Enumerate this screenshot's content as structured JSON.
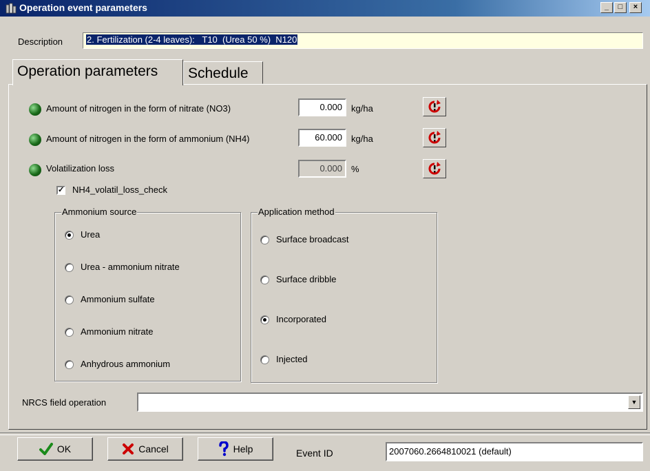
{
  "window": {
    "title": "Operation event parameters",
    "minimize_label": "_",
    "maximize_label": "□",
    "close_label": "×"
  },
  "description": {
    "label": "Description",
    "value": "2. Fertilization (2-4 leaves):   T10  (Urea 50 %)  N120"
  },
  "tabs": [
    {
      "label": "Operation parameters",
      "active": true
    },
    {
      "label": "Schedule",
      "active": false
    }
  ],
  "params": [
    {
      "label": "Amount of nitrogen in the form of nitrate (NO3)",
      "value": "0.000",
      "unit": "kg/ha",
      "enabled": true
    },
    {
      "label": "Amount of nitrogen in the form of ammonium (NH4)",
      "value": "60.000",
      "unit": "kg/ha",
      "enabled": true
    },
    {
      "label": "Volatilization loss",
      "value": "0.000",
      "unit": "%",
      "enabled": false
    }
  ],
  "volatil_check": {
    "label": "NH4_volatil_loss_check",
    "checked": true,
    "mark": "✓"
  },
  "ammonium_source": {
    "title": "Ammonium source",
    "options": [
      "Urea",
      "Urea - ammonium nitrate",
      "Ammonium sulfate",
      "Ammonium nitrate",
      "Anhydrous ammonium"
    ],
    "selected": "Urea"
  },
  "application_method": {
    "title": "Application method",
    "options": [
      "Surface broadcast",
      "Surface dribble",
      "Incorporated",
      "Injected"
    ],
    "selected": "Incorporated"
  },
  "nrcs": {
    "label": "NRCS field operation",
    "value": "",
    "arrow": "▼"
  },
  "buttons": {
    "ok": "OK",
    "cancel": "Cancel",
    "help": "Help"
  },
  "event": {
    "label": "Event ID",
    "value": "2007060.2664810021 (default)"
  },
  "colors": {
    "titlebar": "#0a246a",
    "led": "#1a6b1a",
    "reset_icon": "#cc0000",
    "description_bg": "#ffffe1"
  }
}
